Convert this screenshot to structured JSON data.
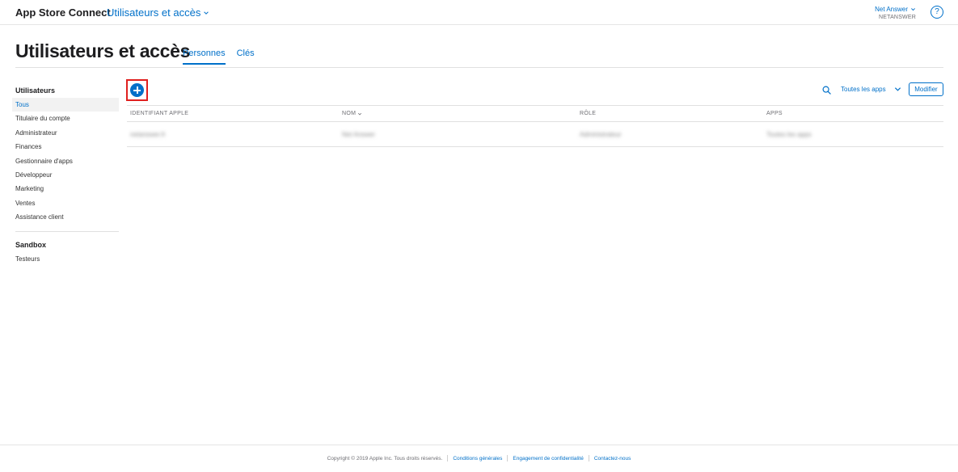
{
  "header": {
    "brand": "App Store Connect",
    "section": "Utilisateurs et accès",
    "account_name": "Net Answer",
    "account_org": "NETANSWER",
    "help_glyph": "?"
  },
  "page": {
    "title": "Utilisateurs et accès",
    "tabs": [
      {
        "label": "Personnes",
        "active": true
      },
      {
        "label": "Clés",
        "active": false
      }
    ]
  },
  "sidebar": {
    "users_heading": "Utilisateurs",
    "users_items": [
      "Tous",
      "Titulaire du compte",
      "Administrateur",
      "Finances",
      "Gestionnaire d'apps",
      "Développeur",
      "Marketing",
      "Ventes",
      "Assistance client"
    ],
    "active_item": "Tous",
    "sandbox_heading": "Sandbox",
    "sandbox_items": [
      "Testeurs"
    ]
  },
  "toolbar": {
    "add_icon": "plus-circle-icon",
    "search_icon": "search-icon",
    "apps_filter": "Toutes les apps",
    "modify_label": "Modifier"
  },
  "table": {
    "columns": [
      "IDENTIFIANT APPLE",
      "NOM",
      "RÔLE",
      "APPS"
    ],
    "sorted_column": "NOM",
    "rows": [
      [
        "netanswer.fr",
        "Net Answer",
        "Administrateur",
        "Toutes les apps"
      ]
    ]
  },
  "footer": {
    "copyright": "Copyright © 2019 Apple Inc. Tous droits réservés.",
    "links": [
      "Conditions générales",
      "Engagement de confidentialité",
      "Contactez-nous"
    ]
  },
  "colors": {
    "accent": "#0070c9",
    "highlight": "#e0201f"
  }
}
